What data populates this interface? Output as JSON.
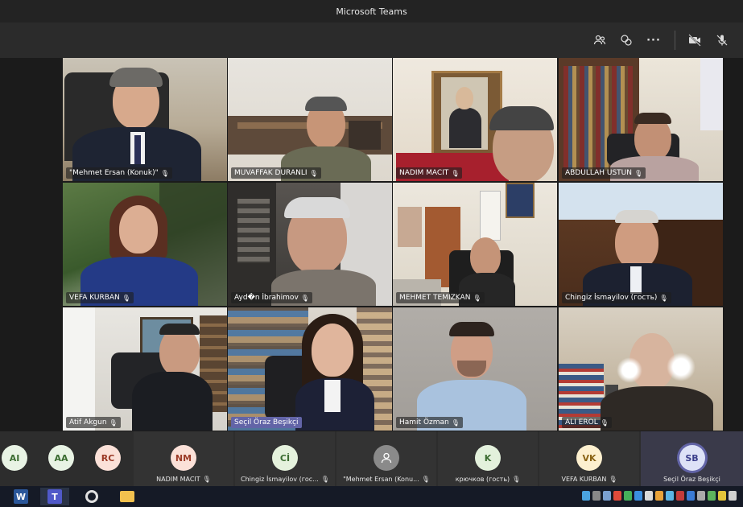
{
  "window": {
    "title": "Microsoft Teams"
  },
  "toolbar": {
    "participants_icon": "people-icon",
    "chat_icon": "chat-icon",
    "more_label": "···",
    "camera_icon": "video-off-icon",
    "mic_icon": "mic-off-icon"
  },
  "tiles": [
    {
      "name": "\"Mehmet Ersan (Konuk)\""
    },
    {
      "name": "MUVAFFAK DURANLI"
    },
    {
      "name": "NADIM MACIT"
    },
    {
      "name": "ABDULLAH USTUN"
    },
    {
      "name": "VEFA KURBAN"
    },
    {
      "name": "Ayd�n İbrahimov"
    },
    {
      "name": "MEHMET TEMIZKAN"
    },
    {
      "name": "Chingiz İsmayilov (гость)"
    },
    {
      "name": "Atif Akgun"
    },
    {
      "name": "Seçil Öraz Beşikçi"
    },
    {
      "name": "Hamit Özman"
    },
    {
      "name": "ALI EROL"
    }
  ],
  "tray": [
    {
      "initials": "AI",
      "name": ""
    },
    {
      "initials": "AA",
      "name": ""
    },
    {
      "initials": "RC",
      "name": ""
    },
    {
      "initials": "NM",
      "name": "NADIM MACIT"
    },
    {
      "initials": "Cİ",
      "name": "Chingiz İsmayilov (гос..."
    },
    {
      "initials": "",
      "name": "\"Mehmet Ersan (Konu..."
    },
    {
      "initials": "K",
      "name": "крючков (гость)"
    },
    {
      "initials": "VK",
      "name": "VEFA KURBAN"
    },
    {
      "initials": "SB",
      "name": "Seçil Öraz Beşikçi"
    }
  ],
  "colors": {
    "accent": "#6264a7",
    "tray_bg": "#2d2d2d",
    "avatar_ai": "#e8f3e4",
    "avatar_nm": "#fbe1d8",
    "avatar_ci": "#e5f2dd",
    "avatar_k": "#e3f1dc",
    "avatar_vk": "#fdf0cf",
    "avatar_sb": "#dde2f7"
  }
}
